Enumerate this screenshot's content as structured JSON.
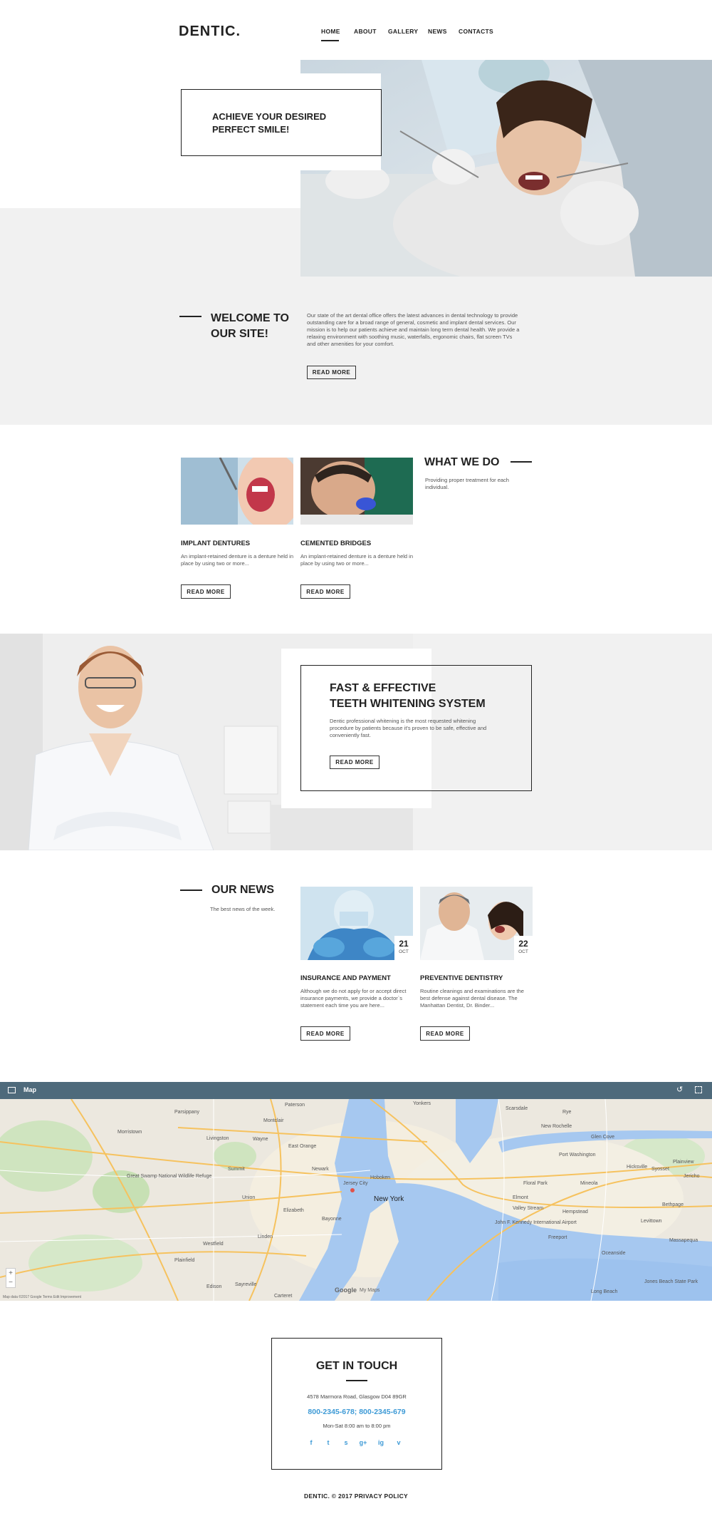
{
  "header": {
    "logo": "DENTIC.",
    "nav": [
      "HOME",
      "ABOUT",
      "GALLERY",
      "NEWS",
      "CONTACTS"
    ]
  },
  "hero": {
    "title_line1": "ACHIEVE YOUR DESIRED",
    "title_line2": "PERFECT SMILE!"
  },
  "welcome": {
    "title_line1": "WELCOME TO",
    "title_line2": "OUR SITE!",
    "text": "Our state of the art dental office offers the latest advances in dental technology to provide outstanding care for a broad range of general, cosmetic and implant dental services. Our mission is to help our patients achieve and maintain long term dental health. We provide a relaxing environment with soothing music, waterfalls, ergonomic chairs, flat screen TVs and other amenities for your comfort.",
    "button": "READ MORE"
  },
  "what_we_do": {
    "title": "WHAT WE DO",
    "subtitle": "Providing proper treatment for each individual.",
    "services": [
      {
        "title": "IMPLANT DENTURES",
        "text": "An implant-retained denture is a denture held in place by using two or more...",
        "button": "READ MORE"
      },
      {
        "title": "CEMENTED BRIDGES",
        "text": "An implant-retained denture is a denture held in place by using two or more...",
        "button": "READ MORE"
      }
    ]
  },
  "whitening": {
    "title_line1": "FAST & EFFECTIVE",
    "title_line2": "TEETH WHITENING SYSTEM",
    "text": "Dentic professional whitening is the most requested whitening procedure by patients because it's proven to be safe, effective and conveniently fast.",
    "button": "READ MORE"
  },
  "news": {
    "title": "OUR NEWS",
    "subtitle": "The best news of the week.",
    "items": [
      {
        "day": "21",
        "month": "OCT",
        "title": "INSURANCE AND PAYMENT",
        "text": "Although we do not apply for or accept direct insurance payments, we provide a doctor`s statement each time you are here...",
        "button": "READ MORE"
      },
      {
        "day": "22",
        "month": "OCT",
        "title": "PREVENTIVE DENTISTRY",
        "text": "Routine cleanings and examinations are the best defense against dental disease. The Manhattan Dentist, Dr. Binder...",
        "button": "READ MORE"
      }
    ]
  },
  "map": {
    "label": "Map",
    "city_label": "New York",
    "labels": [
      "Newark",
      "Jersey City",
      "Elizabeth",
      "Bayonne",
      "Hoboken",
      "Hempstead",
      "Montclair",
      "Paterson",
      "Morristown",
      "Summit",
      "Westfield",
      "Plainfield",
      "Union",
      "Linden",
      "Carteret",
      "Edison",
      "Long Beach",
      "Valley Stream",
      "Levittown",
      "Mineola",
      "Hicksville",
      "Yonkers",
      "Scarsdale",
      "Rye",
      "New Rochelle",
      "Great Swamp National Wildlife Refuge",
      "East Orange",
      "Livingston",
      "Wayne",
      "Parsippany",
      "Sayreville",
      "Oceanside",
      "Freeport",
      "Jones Beach State Park",
      "John F. Kennedy International Airport",
      "Elmont",
      "Floral Park",
      "Port Washington",
      "Glen Cove",
      "Plainview",
      "Syosset",
      "Jericho",
      "Bethpage",
      "Massapequa"
    ],
    "footer": "Map data ©2017 Google   Terms   Edit Improvement",
    "google": "Google",
    "myplaces": "My Maps"
  },
  "contact": {
    "title": "GET IN TOUCH",
    "address": "4578 Marmora Road, Glasgow D04 89GR",
    "phone": "800-2345-678;  800-2345-679",
    "hours": "Mon-Sat 8:00 am to 8:00 pm",
    "social": [
      "f",
      "t",
      "s",
      "g+",
      "ig",
      "v"
    ]
  },
  "footer": {
    "text": "DENTIC. © 2017 PRIVACY POLICY"
  },
  "colors": {
    "accent": "#3d9ad6",
    "grey_band": "#f1f1f1",
    "map_bar": "#4e6a7b"
  }
}
